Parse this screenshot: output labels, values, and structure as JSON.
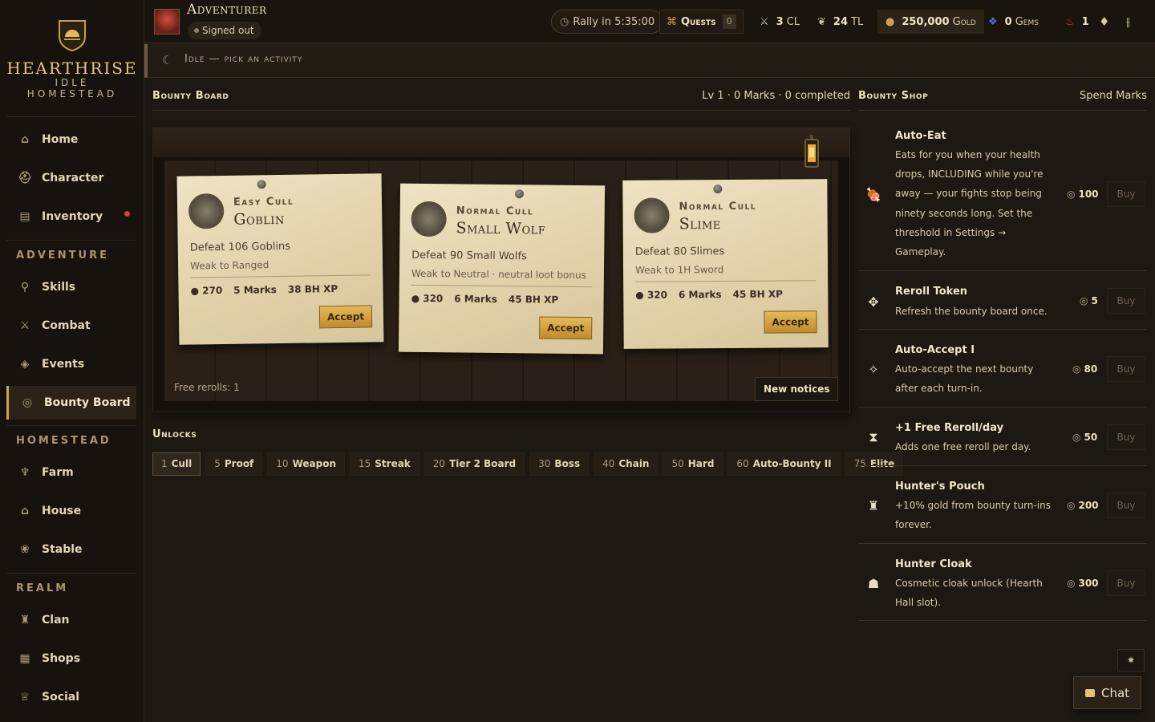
{
  "brand": {
    "name": "HEARTHRISE",
    "sub1": "IDLE",
    "sub2": "HOMESTEAD"
  },
  "sidebar": {
    "items_top": [
      {
        "label": "Home",
        "icon": "home-icon"
      },
      {
        "label": "Character",
        "icon": "helmet-icon"
      },
      {
        "label": "Inventory",
        "icon": "backpack-icon"
      }
    ],
    "section_adventure": "ADVENTURE",
    "items_adventure": [
      {
        "label": "Skills",
        "icon": "running-icon"
      },
      {
        "label": "Combat",
        "icon": "crossed-swords-icon"
      },
      {
        "label": "Events",
        "icon": "shield-icon"
      },
      {
        "label": "Bounty Board",
        "icon": "target-icon"
      }
    ],
    "section_homestead": "HOMESTEAD",
    "items_homestead": [
      {
        "label": "Farm",
        "icon": "wheat-icon"
      },
      {
        "label": "House",
        "icon": "house-icon"
      },
      {
        "label": "Stable",
        "icon": "paw-icon"
      }
    ],
    "section_realm": "REALM",
    "items_realm": [
      {
        "label": "Clan",
        "icon": "castle-icon"
      },
      {
        "label": "Shops",
        "icon": "shop-icon"
      },
      {
        "label": "Social",
        "icon": "trophy-icon"
      }
    ]
  },
  "topbar": {
    "player_name": "Adventurer",
    "status": "Signed out",
    "rally": "Rally in 5:35:00",
    "quests_label": "Quests",
    "quests_count": "0",
    "cl_value": "3",
    "cl_label": "CL",
    "tl_value": "24",
    "tl_label": "TL",
    "gold_value": "250,000",
    "gold_label": "Gold",
    "gems_value": "0",
    "gems_label": "Gems",
    "fire_value": "1"
  },
  "activity": {
    "text": "Idle — pick an activity"
  },
  "board": {
    "title": "Bounty Board",
    "summary": "Lv 1 · 0 Marks · 0 completed",
    "notices": [
      {
        "difficulty": "Easy Cull",
        "monster": "Goblin",
        "task": "Defeat 106 Goblins",
        "weakness": "Weak to Ranged",
        "gold": "270",
        "marks": "5 Marks",
        "xp": "38 BH XP",
        "accept": "Accept"
      },
      {
        "difficulty": "Normal Cull",
        "monster": "Small Wolf",
        "task": "Defeat 90 Small Wolfs",
        "weakness": "Weak to Neutral · neutral loot bonus",
        "gold": "320",
        "marks": "6 Marks",
        "xp": "45 BH XP",
        "accept": "Accept"
      },
      {
        "difficulty": "Normal Cull",
        "monster": "Slime",
        "task": "Defeat 80 Slimes",
        "weakness": "Weak to 1H Sword",
        "gold": "320",
        "marks": "6 Marks",
        "xp": "45 BH XP",
        "accept": "Accept"
      }
    ],
    "free_rerolls": "Free rerolls: 1",
    "new_notices": "New notices"
  },
  "unlocks": {
    "title": "Unlocks",
    "items": [
      {
        "n": "1",
        "label": "Cull"
      },
      {
        "n": "5",
        "label": "Proof"
      },
      {
        "n": "10",
        "label": "Weapon"
      },
      {
        "n": "15",
        "label": "Streak"
      },
      {
        "n": "20",
        "label": "Tier 2 Board"
      },
      {
        "n": "30",
        "label": "Boss"
      },
      {
        "n": "40",
        "label": "Chain"
      },
      {
        "n": "50",
        "label": "Hard"
      },
      {
        "n": "60",
        "label": "Auto-Bounty II"
      },
      {
        "n": "75",
        "label": "Elite"
      }
    ]
  },
  "shop": {
    "title": "Bounty Shop",
    "subtitle": "Spend Marks",
    "buy_label": "Buy",
    "items": [
      {
        "name": "Auto-Eat",
        "desc": "Eats for you when your health drops, INCLUDING while you're away — your fights stop being ninety seconds long. Set the threshold in Settings → Gameplay.",
        "price": "100",
        "icon": "meat-icon"
      },
      {
        "name": "Reroll Token",
        "desc": "Refresh the bounty board once.",
        "price": "5",
        "icon": "token-icon"
      },
      {
        "name": "Auto-Accept I",
        "desc": "Auto-accept the next bounty after each turn-in.",
        "price": "80",
        "icon": "sparkle-icon"
      },
      {
        "name": "+1 Free Reroll/day",
        "desc": "Adds one free reroll per day.",
        "price": "50",
        "icon": "hourglass-icon"
      },
      {
        "name": "Hunter's Pouch",
        "desc": "+10% gold from bounty turn-ins forever.",
        "price": "200",
        "icon": "pouch-icon"
      },
      {
        "name": "Hunter Cloak",
        "desc": "Cosmetic cloak unlock (Hearth Hall slot).",
        "price": "300",
        "icon": "cloak-icon"
      }
    ]
  },
  "chat": {
    "label": "Chat"
  }
}
